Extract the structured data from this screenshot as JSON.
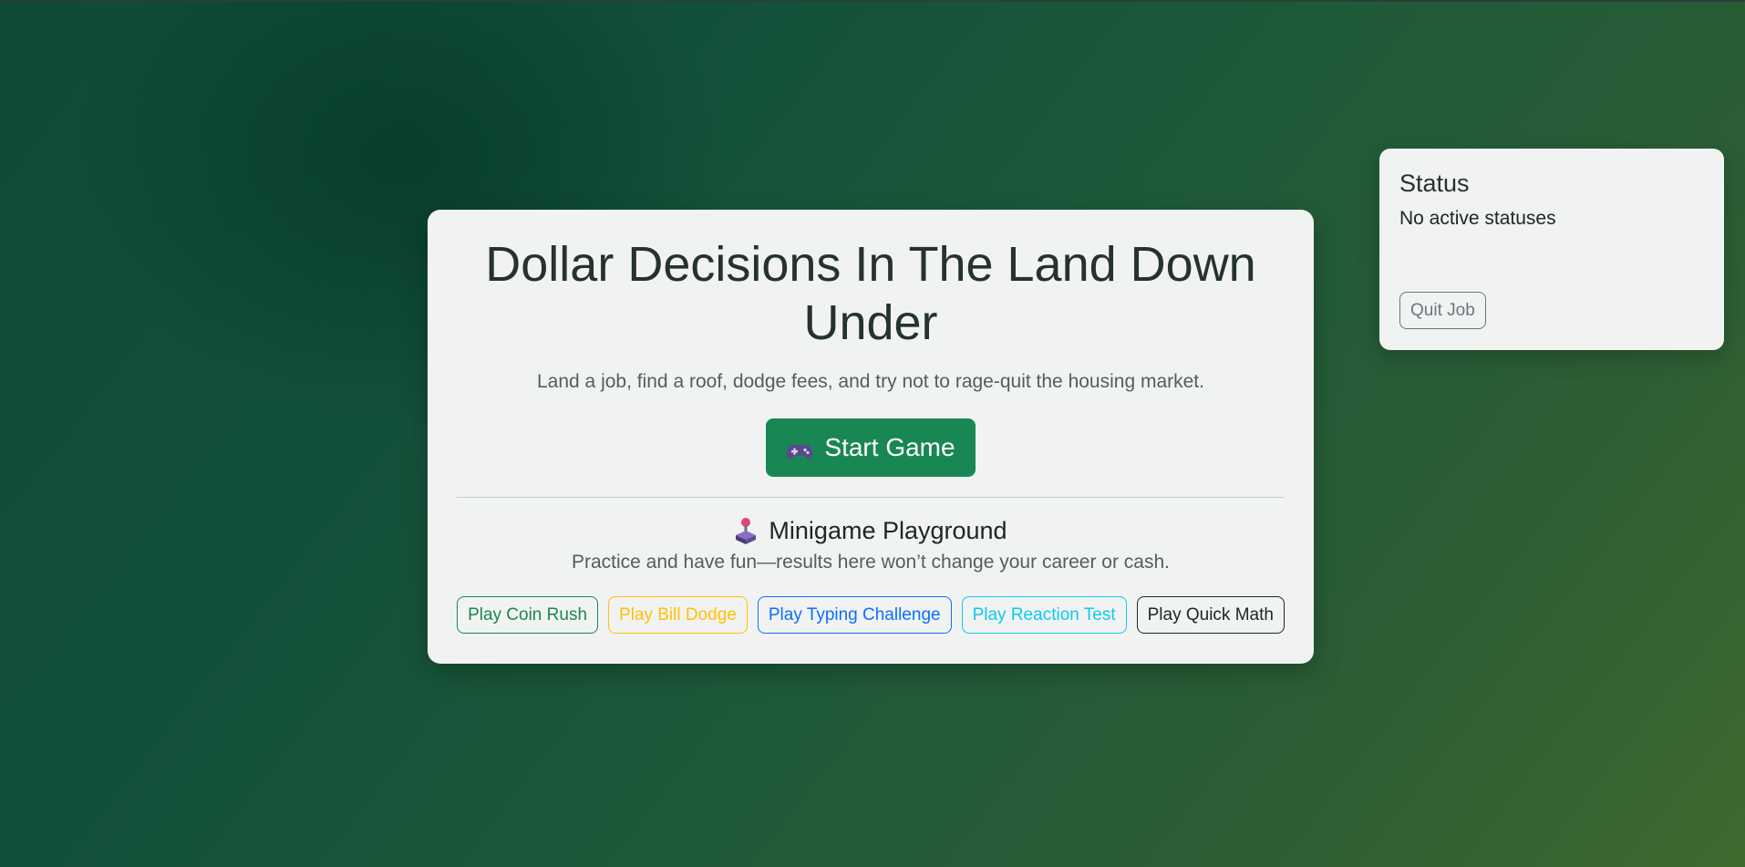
{
  "main": {
    "title": "Dollar Decisions In The Land Down Under",
    "subtitle": "Land a job, find a roof, dodge fees, and try not to rage-quit the housing market.",
    "start_button": {
      "icon": "gamepad-icon",
      "label": "Start Game"
    },
    "minigames": {
      "icon": "joystick-icon",
      "heading": "Minigame Playground",
      "description": "Practice and have fun—results here won’t change your career or cash.",
      "buttons": [
        {
          "label": "Play Coin Rush",
          "color": "#198754"
        },
        {
          "label": "Play Bill Dodge",
          "color": "#ffc107"
        },
        {
          "label": "Play Typing Challenge",
          "color": "#0d6efd"
        },
        {
          "label": "Play Reaction Test",
          "color": "#0dcaf0"
        },
        {
          "label": "Play Quick Math",
          "color": "#212529"
        }
      ]
    }
  },
  "status_panel": {
    "title": "Status",
    "text": "No active statuses",
    "quit_button": "Quit Job"
  },
  "colors": {
    "accent": "#198754",
    "card_background": "#f1f3f2",
    "page_background_dark": "#0f4a35",
    "page_background_light": "#3f6a2e"
  }
}
